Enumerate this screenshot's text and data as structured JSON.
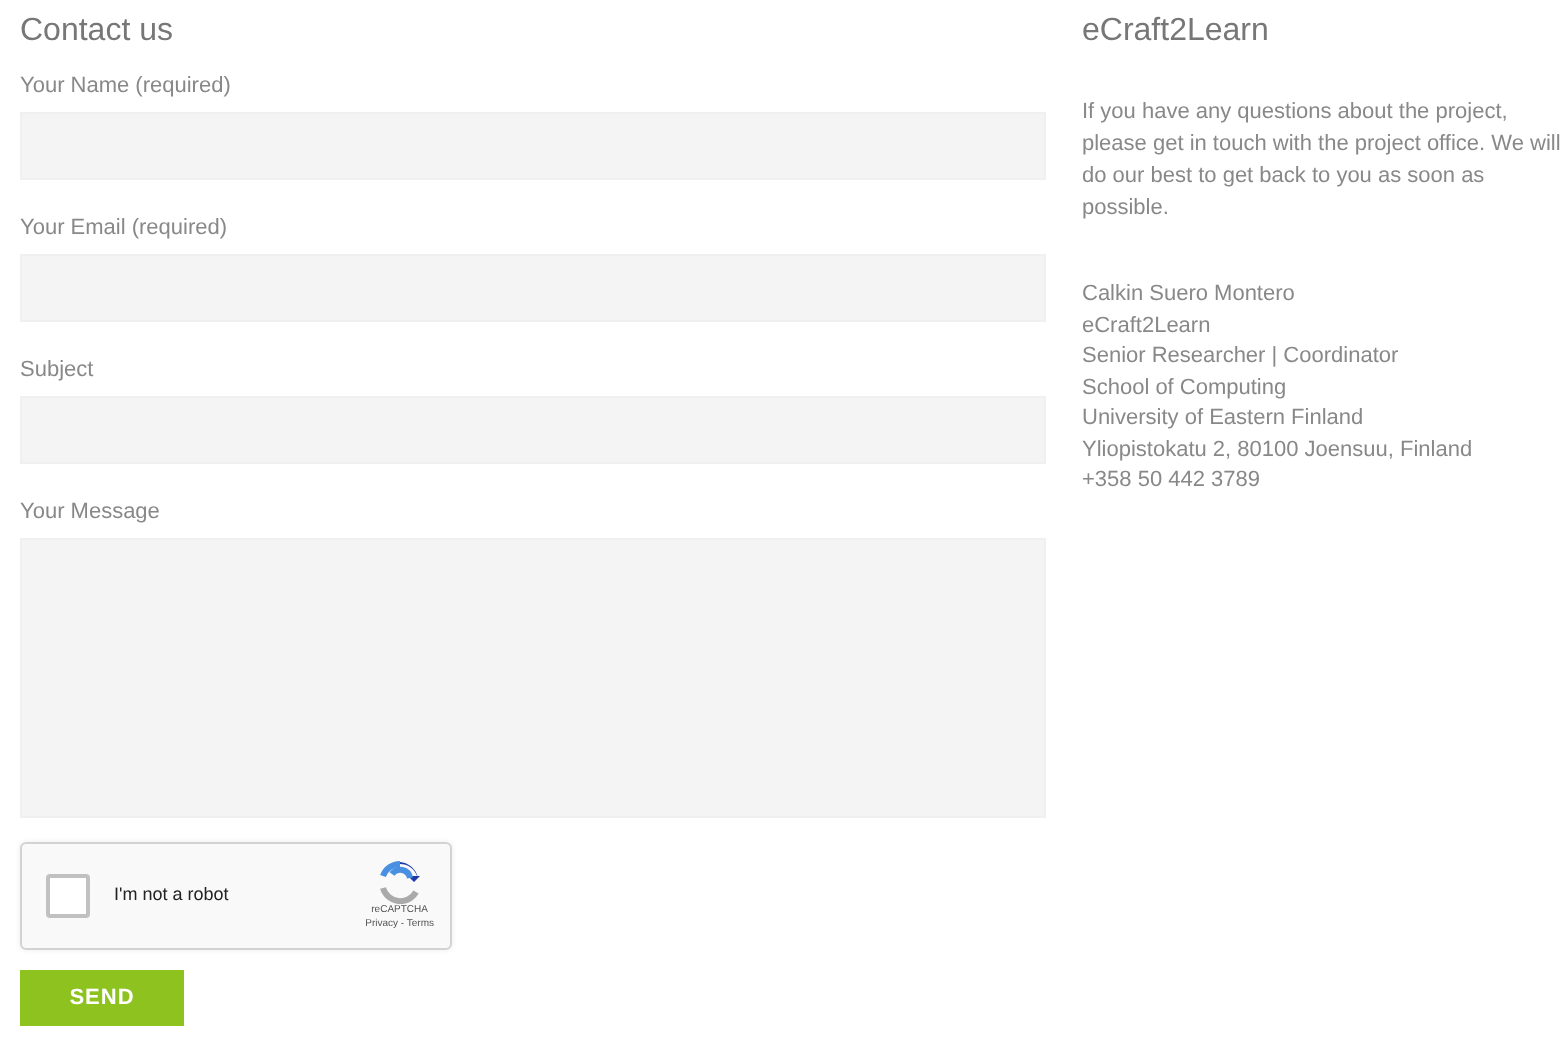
{
  "form": {
    "title": "Contact us",
    "fields": [
      {
        "label": "Your Name (required)",
        "kind": "text"
      },
      {
        "label": "Your Email (required)",
        "kind": "text"
      },
      {
        "label": "Subject",
        "kind": "text"
      },
      {
        "label": "Your Message",
        "kind": "textarea"
      }
    ],
    "captcha": {
      "label": "I'm not a robot",
      "checked": false,
      "brand": "reCAPTCHA",
      "links": "Privacy - Terms"
    },
    "submit": "SEND"
  },
  "sidebar": {
    "title": "eCraft2Learn",
    "intro": "If you have any questions about the project, please get in touch with the project office. We will do our best to get back to you as soon as possible.",
    "contact_lines": [
      "Calkin Suero Montero",
      "eCraft2Learn",
      "Senior Researcher | Coordinator",
      "School of Computing",
      "University of Eastern Finland",
      "Yliopistokatu 2, 80100 Joensuu, Finland",
      "+358 50 442 3789"
    ]
  }
}
